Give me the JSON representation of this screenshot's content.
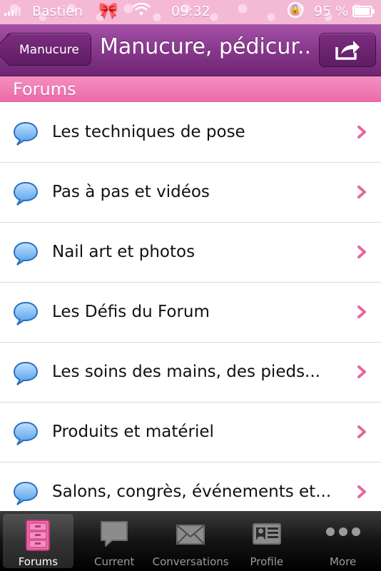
{
  "status_bar": {
    "carrier": "Bastien",
    "time": "09:32",
    "battery_percent": "95 %",
    "battery_level": 0.95,
    "icons": [
      "signal-icon",
      "bow-icon",
      "wifi-icon",
      "rotation-lock-icon",
      "battery-icon"
    ]
  },
  "nav": {
    "back_label": "Manucure",
    "title": "Manucure, pédicur...",
    "share_icon": "share-icon"
  },
  "section": {
    "title": "Forums"
  },
  "forums": [
    {
      "label": "Les techniques de pose"
    },
    {
      "label": "Pas à pas et vidéos"
    },
    {
      "label": "Nail art et photos"
    },
    {
      "label": "Les Défis du Forum"
    },
    {
      "label": "Les soins des mains, des pieds..."
    },
    {
      "label": "Produits et matériel"
    },
    {
      "label": "Salons, congrès, événements et..."
    }
  ],
  "tabs": [
    {
      "label": "Forums",
      "icon": "forums-icon",
      "active": true
    },
    {
      "label": "Current",
      "icon": "speech-bubble-icon",
      "active": false
    },
    {
      "label": "Conversations",
      "icon": "envelope-icon",
      "active": false
    },
    {
      "label": "Profile",
      "icon": "profile-card-icon",
      "active": false
    },
    {
      "label": "More",
      "icon": "more-dots-icon",
      "active": false
    }
  ],
  "colors": {
    "nav_purple": "#8a3a8f",
    "section_pink": "#ec6aa8",
    "chevron_pink": "#e8679f",
    "bubble_blue": "#3a8fe0",
    "forums_tab_pink": "#f06aa6"
  }
}
